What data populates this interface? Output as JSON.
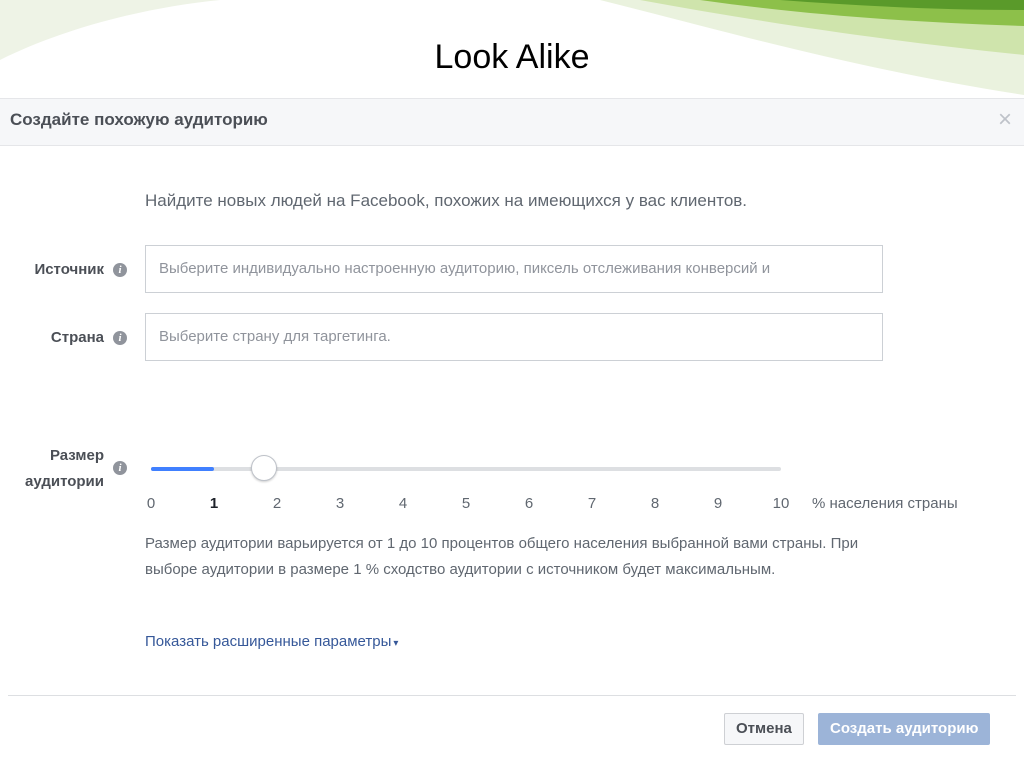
{
  "slide": {
    "title": "Look Alike"
  },
  "dialog": {
    "title": "Создайте похожую аудиторию",
    "close_icon": "close-icon",
    "intro": "Найдите новых людей на Facebook, похожих на имеющихся у вас клиентов.",
    "source": {
      "label": "Источник",
      "placeholder": "Выберите индивидуально настроенную аудиторию, пиксель отслеживания конверсий и"
    },
    "country": {
      "label": "Страна",
      "placeholder": "Выберите страну для таргетинга."
    },
    "size": {
      "label_line1": "Размер",
      "label_line2": "аудитории",
      "min": 0,
      "max": 10,
      "value": 1,
      "ticks": [
        "0",
        "1",
        "2",
        "3",
        "4",
        "5",
        "6",
        "7",
        "8",
        "9",
        "10"
      ],
      "unit": "% населения страны",
      "accent_color": "#4080ff"
    },
    "description": "Размер аудитории варьируется от 1 до 10 процентов общего населения выбранной вами страны. При выборе аудитории в размере 1 % сходство аудитории с источником будет максимальным.",
    "advanced_link": "Показать расширенные параметры",
    "buttons": {
      "cancel": "Отмена",
      "create": "Создать аудиторию"
    }
  }
}
